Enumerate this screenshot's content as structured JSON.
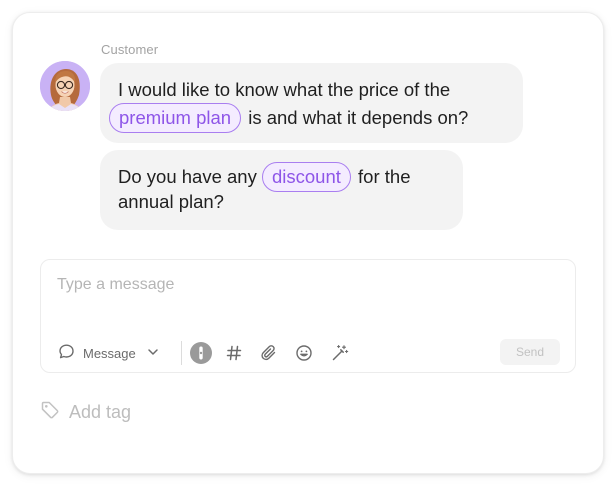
{
  "chat": {
    "sender_label": "Customer",
    "messages": [
      {
        "line1": {
          "before": "I would like to know what the price of the"
        },
        "line2": {
          "tag": "premium plan",
          "after": "is and what it depends on?"
        }
      },
      {
        "line1": {
          "before": "Do you have any",
          "tag": "discount",
          "after": "for the"
        },
        "line2": {
          "before": "annual plan?"
        }
      }
    ]
  },
  "composer": {
    "placeholder": "Type a message",
    "message_type_label": "Message",
    "send_label": "Send",
    "icons": [
      "chat-bubble-icon",
      "chevron-down-icon",
      "ai-assist-icon",
      "hashtag-icon",
      "paperclip-icon",
      "emoji-icon",
      "magic-wand-icon"
    ]
  },
  "footer": {
    "add_tag_label": "Add tag",
    "icon": "tag-icon"
  },
  "colors": {
    "accent": "#8e55e8",
    "tag_border": "#a97ef0",
    "tag_bg": "#f4ecff",
    "bubble_bg": "#f3f3f3",
    "avatar_bg": "#c9b2f5"
  }
}
